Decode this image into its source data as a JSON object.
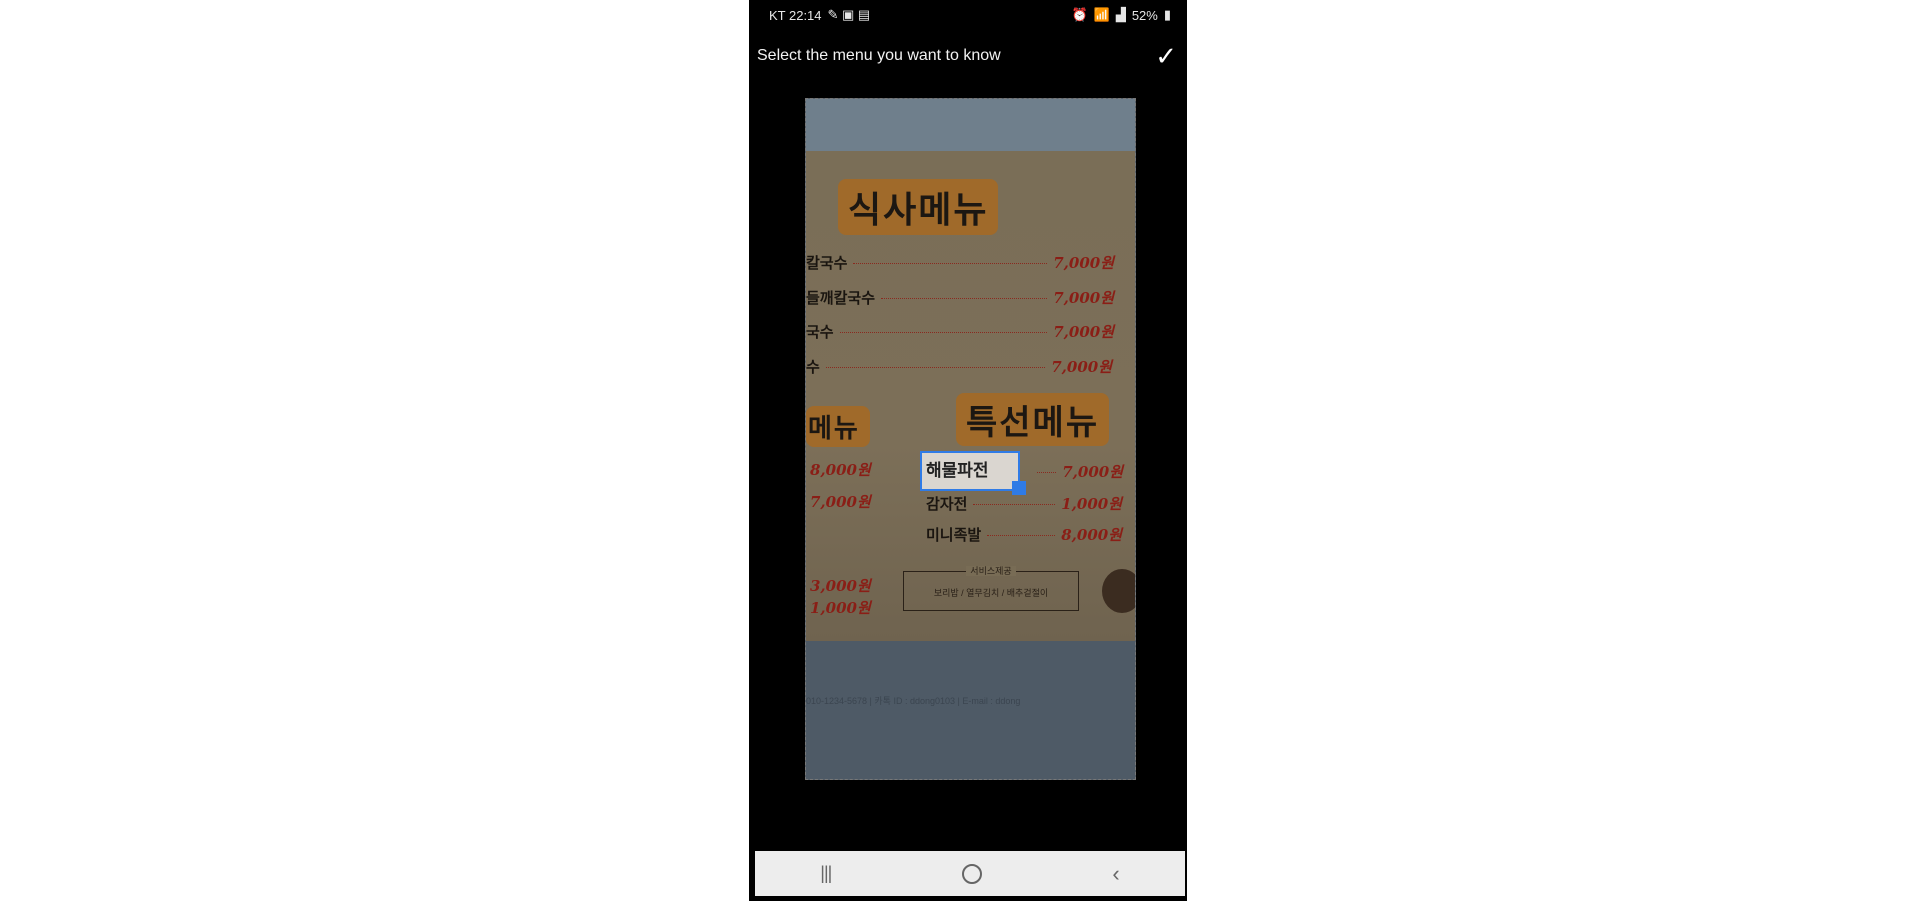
{
  "status_bar": {
    "carrier_time": "KT 22:14",
    "battery": "52%"
  },
  "app_bar": {
    "title": "Select the menu you want to know"
  },
  "menu_board": {
    "heading_meal": "식사메뉴",
    "heading_left_partial": "메뉴",
    "heading_special": "특선메뉴",
    "meal_items": [
      {
        "name": "칼국수",
        "price": "7,000원"
      },
      {
        "name": "들깨칼국수",
        "price": "7,000원"
      },
      {
        "name": "국수",
        "price": "7,000원"
      },
      {
        "name": "수",
        "price": "7,000원"
      }
    ],
    "left_items": [
      {
        "price": "8,000원"
      },
      {
        "price": "7,000원"
      }
    ],
    "special_items": [
      {
        "name": "해물파전",
        "price": "7,000원"
      },
      {
        "name": "감자전",
        "price": "1,000원"
      },
      {
        "name": "미니족발",
        "price": "8,000원"
      }
    ],
    "bottom_left_items": [
      {
        "price": "3,000원"
      },
      {
        "price": "1,000원"
      }
    ],
    "service_title": "서비스제공",
    "service_text": "보리밥 / 열무김치 / 배추겉절이",
    "footer_text": "010-1234-5678   |   카톡 ID : ddong0103   |   E-mail : ddong"
  },
  "selection": {
    "text": "해물파전"
  },
  "nav_bar": {
    "recents_glyph": "|||",
    "back_glyph": "‹"
  },
  "colors": {
    "accent": "#2f7be6",
    "background": "#000000",
    "nav_bar": "#ededed"
  }
}
